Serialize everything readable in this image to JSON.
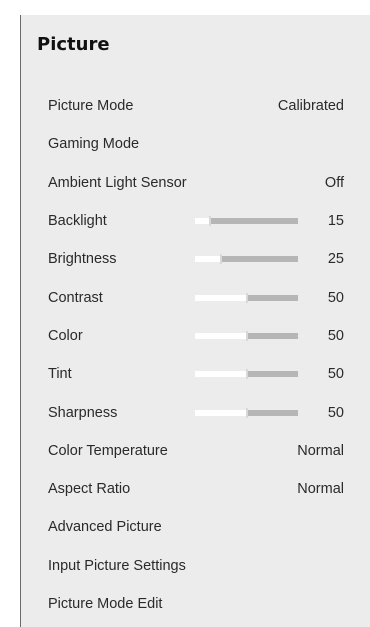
{
  "title": "Picture",
  "items": [
    {
      "label": "Picture Mode",
      "value": "Calibrated"
    },
    {
      "label": "Gaming Mode",
      "value": ""
    },
    {
      "label": "Ambient Light Sensor",
      "value": "Off"
    },
    {
      "label": "Backlight",
      "slider": 15,
      "value": "15"
    },
    {
      "label": "Brightness",
      "slider": 25,
      "value": "25"
    },
    {
      "label": "Contrast",
      "slider": 50,
      "value": "50"
    },
    {
      "label": "Color",
      "slider": 50,
      "value": "50"
    },
    {
      "label": "Tint",
      "slider": 50,
      "value": "50"
    },
    {
      "label": "Sharpness",
      "slider": 50,
      "value": "50"
    },
    {
      "label": "Color Temperature",
      "value": "Normal"
    },
    {
      "label": "Aspect Ratio",
      "value": "Normal"
    },
    {
      "label": "Advanced Picture",
      "value": ""
    },
    {
      "label": "Input Picture Settings",
      "value": ""
    },
    {
      "label": "Picture Mode Edit",
      "value": ""
    }
  ]
}
